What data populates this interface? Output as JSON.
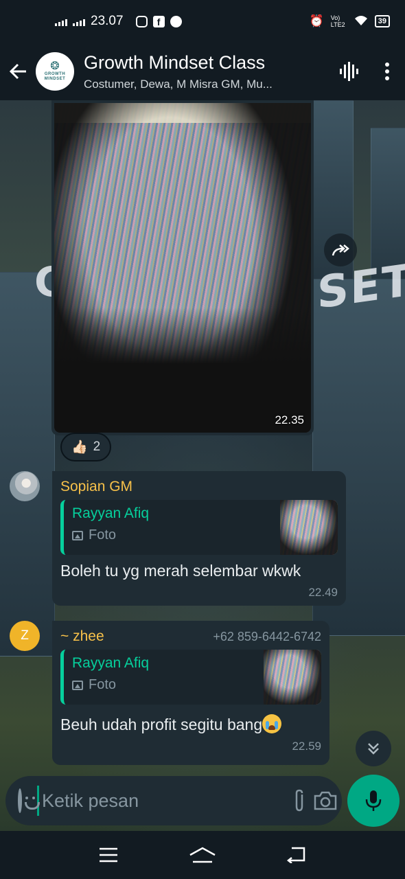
{
  "status_bar": {
    "time": "23.07",
    "lte_label": "Vo) LTE2",
    "battery": "39"
  },
  "header": {
    "title": "Growth Mindset Class",
    "subtitle": "Costumer, Dewa, M Misra GM, Mu...",
    "avatar_text": "GROWTH MINDSET"
  },
  "wallpaper": {
    "sign_left": "G",
    "sign_right": "SET"
  },
  "image_message": {
    "time": "22.35",
    "reaction_emoji": "👍🏻",
    "reaction_count": "2"
  },
  "messages": [
    {
      "sender": "Sopian GM",
      "sender_phone": "",
      "reply_to_author": "Rayyan Afiq",
      "reply_to_kind": "Foto",
      "text": "Boleh tu yg merah selembar wkwk",
      "time": "22.49",
      "avatar_letter": ""
    },
    {
      "sender": "~ zhee",
      "sender_phone": "+62 859-6442-6742",
      "reply_to_author": "Rayyan Afiq",
      "reply_to_kind": "Foto",
      "text": "Beuh udah profit segitu bang",
      "time": "22.59",
      "avatar_letter": "Z"
    }
  ],
  "composer": {
    "placeholder": "Ketik pesan"
  },
  "colors": {
    "accent": "#00a884",
    "sender_name": "#f7c14a",
    "quote_author": "#06cf9c",
    "bubble": "#1f2c34"
  }
}
